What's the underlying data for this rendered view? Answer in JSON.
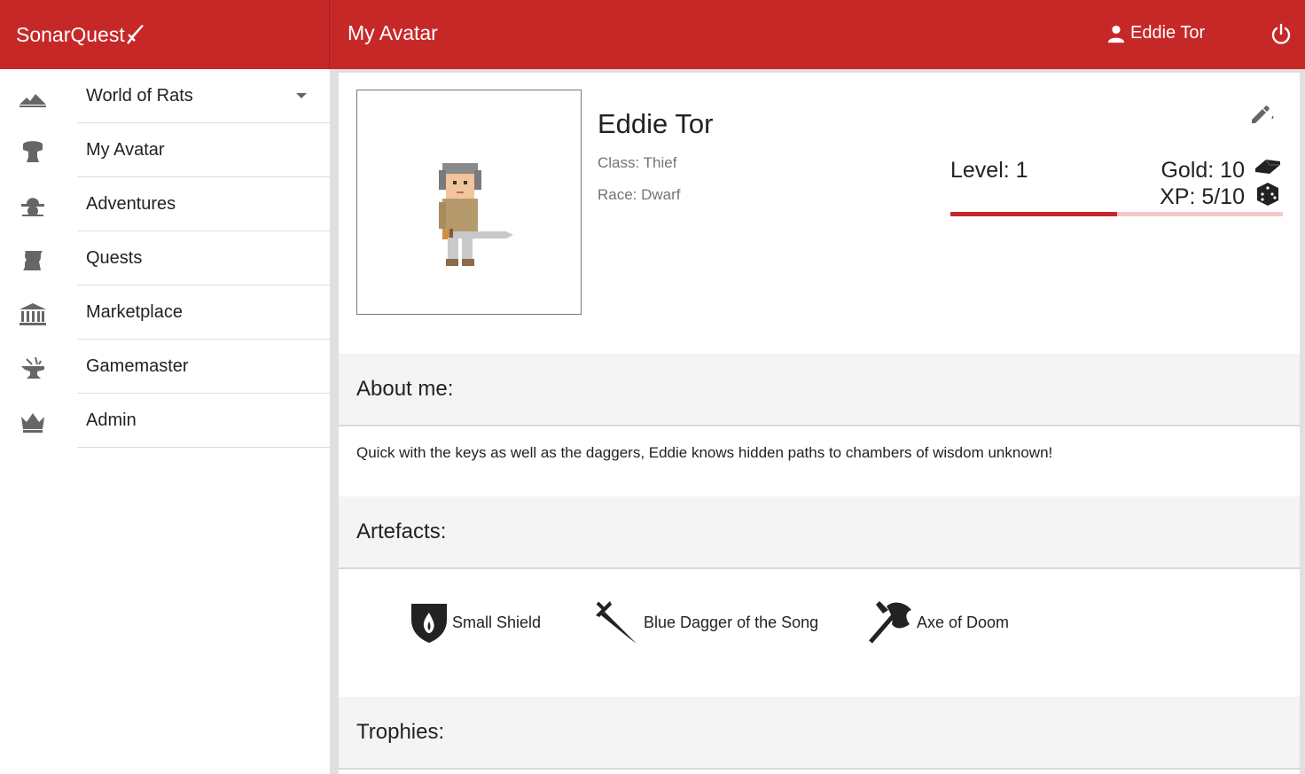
{
  "app": {
    "brand": "SonarQuest",
    "page_title": "My Avatar",
    "user_name": "Eddie Tor",
    "accent_color": "#c62828"
  },
  "sidebar": {
    "items": [
      {
        "label": "World of Rats",
        "icon": "world-icon",
        "has_dropdown": true
      },
      {
        "label": "My Avatar",
        "icon": "knight-helmet-icon"
      },
      {
        "label": "Adventures",
        "icon": "skull-hat-icon"
      },
      {
        "label": "Quests",
        "icon": "scroll-icon"
      },
      {
        "label": "Marketplace",
        "icon": "bank-icon"
      },
      {
        "label": "Gamemaster",
        "icon": "anvil-icon"
      },
      {
        "label": "Admin",
        "icon": "crown-icon"
      }
    ]
  },
  "avatar": {
    "name": "Eddie Tor",
    "class": "Class: Thief",
    "race": "Race: Dwarf",
    "level": "Level: 1",
    "gold": "Gold: 10",
    "xp": "XP: 5/10",
    "xp_fraction": 0.5
  },
  "sections": {
    "about_title": "About me:",
    "about_text": "Quick with the keys as well as the daggers, Eddie knows hidden paths to chambers of wisdom unknown!",
    "artefacts_title": "Artefacts:",
    "trophies_title": "Trophies:"
  },
  "artefacts": [
    {
      "name": "Small Shield",
      "icon": "shield-icon"
    },
    {
      "name": "Blue Dagger of the Song",
      "icon": "dagger-icon"
    },
    {
      "name": "Axe of Doom",
      "icon": "axe-icon"
    }
  ]
}
